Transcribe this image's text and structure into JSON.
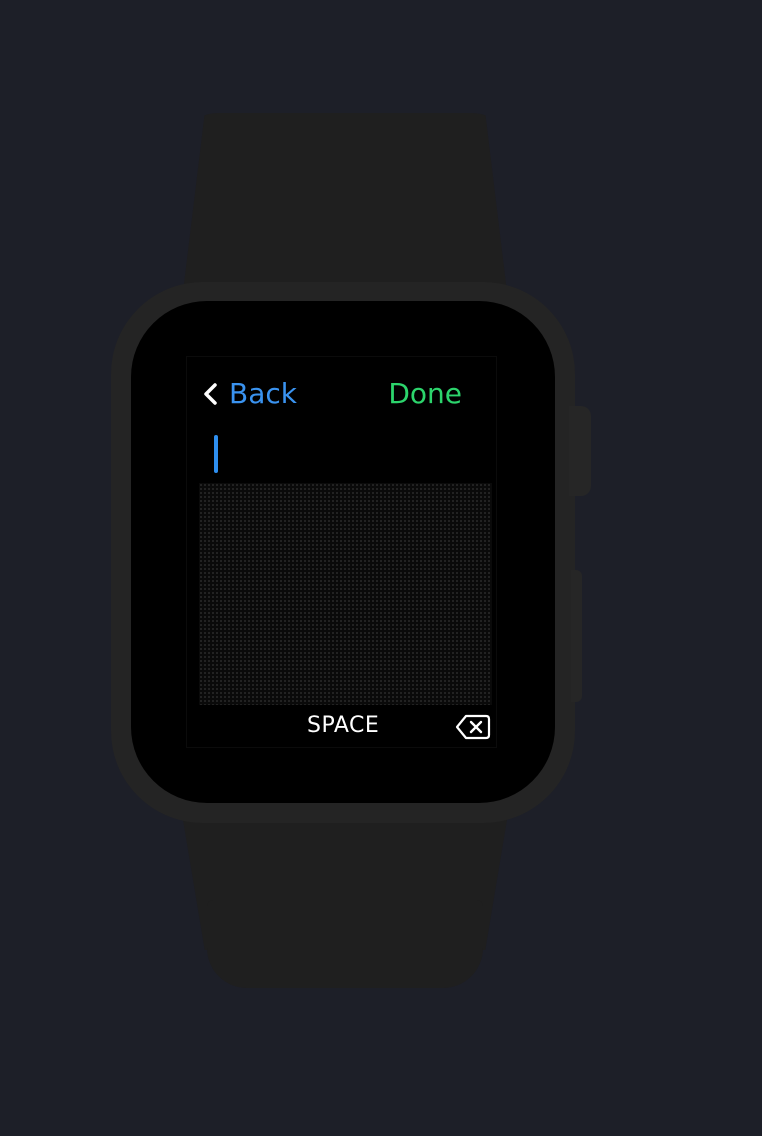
{
  "nav": {
    "back_label": "Back",
    "done_label": "Done"
  },
  "input": {
    "value": ""
  },
  "keyboard": {
    "space_label": "SPACE",
    "delete_icon": "delete-left-icon"
  },
  "colors": {
    "back": "#3a93f0",
    "done": "#2cd46c",
    "caret": "#2e8ff0"
  }
}
